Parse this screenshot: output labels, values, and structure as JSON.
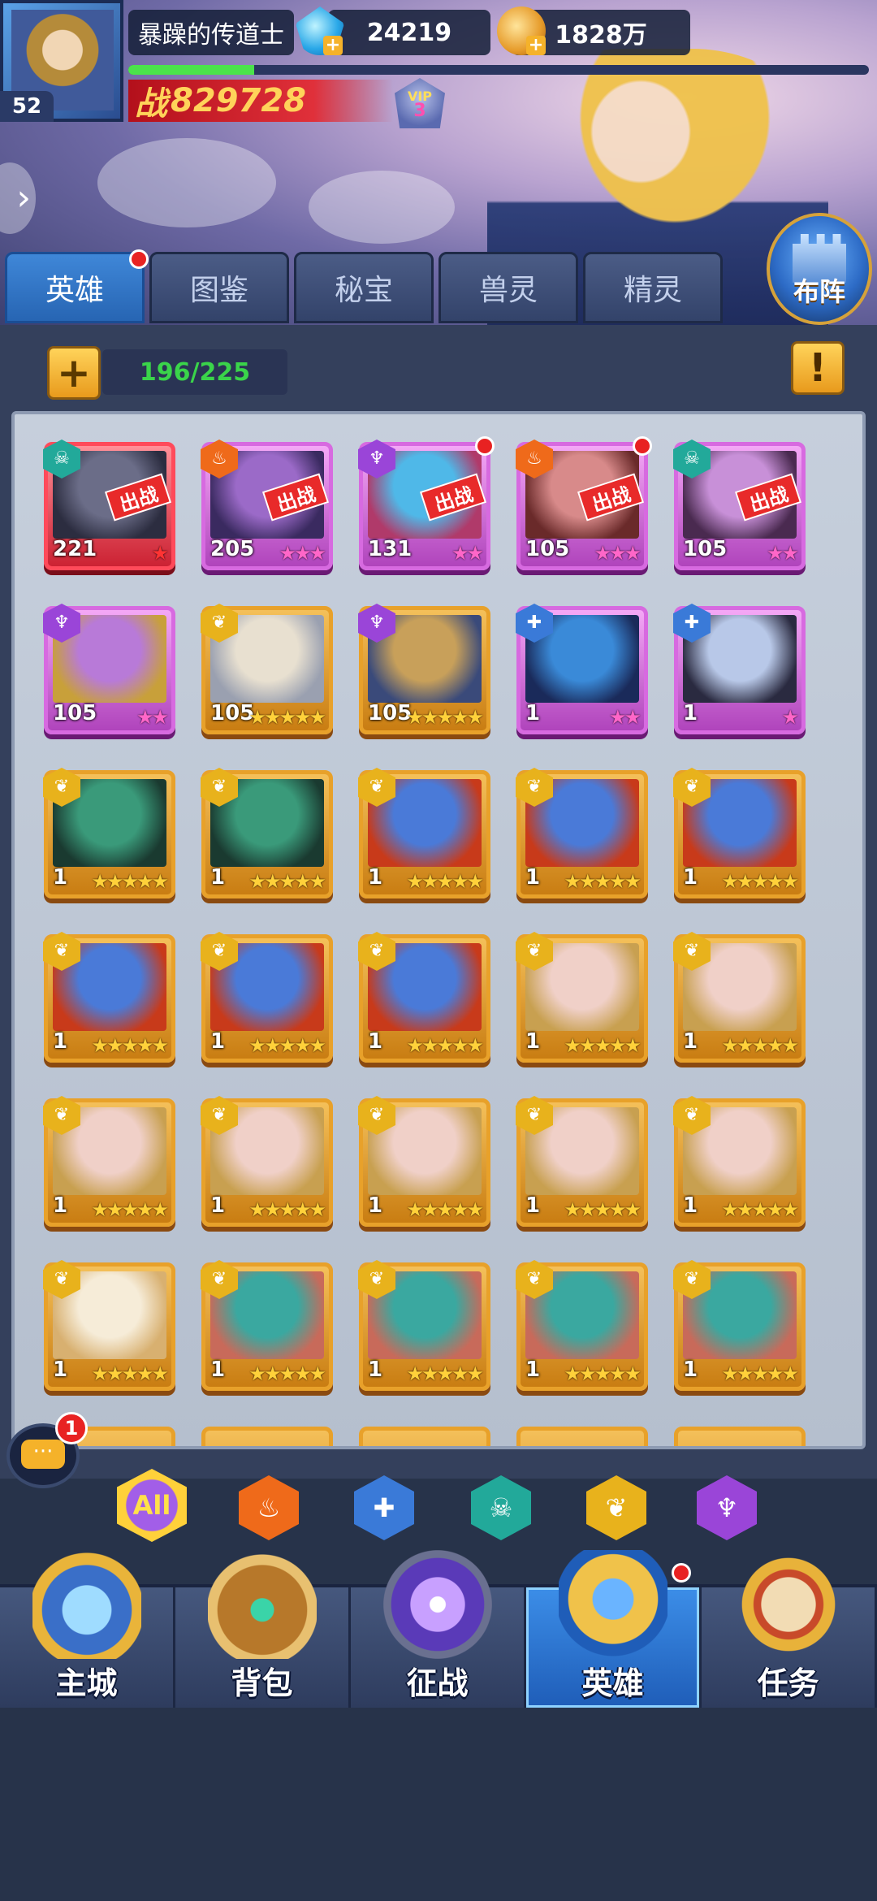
{
  "player": {
    "name": "暴躁的传道士",
    "level": "52",
    "gems": "24219",
    "gold": "1828万",
    "power_label": "战",
    "power": "829728",
    "vip_label": "VIP",
    "vip_level": "3",
    "xp_progress": 0.17
  },
  "tabs": [
    {
      "label": "英雄",
      "active": true,
      "has_notification": true
    },
    {
      "label": "图鉴",
      "active": false
    },
    {
      "label": "秘宝",
      "active": false
    },
    {
      "label": "兽灵",
      "active": false
    },
    {
      "label": "精灵",
      "active": false
    }
  ],
  "formation_label": "布阵",
  "hero_count": "196/225",
  "info_icon": "!",
  "deploy_tag": "出战",
  "heroes": [
    {
      "level": "221",
      "stars": 1,
      "star_color": "red",
      "rarity": "red",
      "faction": "skull",
      "deployed": true,
      "dot": false,
      "portrait": [
        "#6b6d88",
        "#2c2d40"
      ]
    },
    {
      "level": "205",
      "stars": 3,
      "star_color": "pink",
      "rarity": "purple",
      "faction": "fire",
      "deployed": true,
      "dot": false,
      "portrait": [
        "#9b6ac8",
        "#3a2a60"
      ]
    },
    {
      "level": "131",
      "stars": 2,
      "star_color": "pink",
      "rarity": "purple",
      "faction": "dark",
      "deployed": true,
      "dot": true,
      "portrait": [
        "#4fb8e8",
        "#b03a6a"
      ]
    },
    {
      "level": "105",
      "stars": 3,
      "star_color": "pink",
      "rarity": "purple",
      "faction": "fire",
      "deployed": true,
      "dot": true,
      "portrait": [
        "#d88a8a",
        "#6a2a2a"
      ]
    },
    {
      "level": "105",
      "stars": 2,
      "star_color": "pink",
      "rarity": "purple",
      "faction": "skull",
      "deployed": true,
      "dot": false,
      "portrait": [
        "#c890d8",
        "#4a2a50"
      ]
    },
    {
      "level": "105",
      "stars": 2,
      "star_color": "pink",
      "rarity": "purple",
      "faction": "dark",
      "deployed": false,
      "dot": false,
      "portrait": [
        "#b87ad8",
        "#c8a03a"
      ]
    },
    {
      "level": "105",
      "stars": 5,
      "star_color": "gold",
      "rarity": "gold",
      "faction": "leaf",
      "deployed": false,
      "dot": false,
      "portrait": [
        "#e8e0d0",
        "#9aa0b0"
      ]
    },
    {
      "level": "105",
      "stars": 5,
      "star_color": "gold",
      "rarity": "gold",
      "faction": "dark",
      "deployed": false,
      "dot": false,
      "portrait": [
        "#c8a05a",
        "#3a4a7a"
      ]
    },
    {
      "level": "1",
      "stars": 2,
      "star_color": "pink",
      "rarity": "purple",
      "faction": "holy",
      "deployed": false,
      "dot": false,
      "portrait": [
        "#3a8ad8",
        "#1a2a5a"
      ]
    },
    {
      "level": "1",
      "stars": 1,
      "star_color": "pink",
      "rarity": "purple",
      "faction": "holy",
      "deployed": false,
      "dot": false,
      "portrait": [
        "#b8c8e8",
        "#2a2a40"
      ]
    },
    {
      "level": "1",
      "stars": 5,
      "star_color": "gold",
      "rarity": "gold",
      "faction": "leaf",
      "deployed": false,
      "dot": false,
      "portrait": [
        "#3a9a7a",
        "#1a3a30"
      ]
    },
    {
      "level": "1",
      "stars": 5,
      "star_color": "gold",
      "rarity": "gold",
      "faction": "leaf",
      "deployed": false,
      "dot": false,
      "portrait": [
        "#3a9a7a",
        "#1a3a30"
      ]
    },
    {
      "level": "1",
      "stars": 5,
      "star_color": "gold",
      "rarity": "gold",
      "faction": "leaf",
      "deployed": false,
      "dot": false,
      "portrait": [
        "#4a7ad8",
        "#c83a1a"
      ]
    },
    {
      "level": "1",
      "stars": 5,
      "star_color": "gold",
      "rarity": "gold",
      "faction": "leaf",
      "deployed": false,
      "dot": false,
      "portrait": [
        "#4a7ad8",
        "#c83a1a"
      ]
    },
    {
      "level": "1",
      "stars": 5,
      "star_color": "gold",
      "rarity": "gold",
      "faction": "leaf",
      "deployed": false,
      "dot": false,
      "portrait": [
        "#4a7ad8",
        "#c83a1a"
      ]
    },
    {
      "level": "1",
      "stars": 5,
      "star_color": "gold",
      "rarity": "gold",
      "faction": "leaf",
      "deployed": false,
      "dot": false,
      "portrait": [
        "#4a7ad8",
        "#c83a1a"
      ]
    },
    {
      "level": "1",
      "stars": 5,
      "star_color": "gold",
      "rarity": "gold",
      "faction": "leaf",
      "deployed": false,
      "dot": false,
      "portrait": [
        "#4a7ad8",
        "#c83a1a"
      ]
    },
    {
      "level": "1",
      "stars": 5,
      "star_color": "gold",
      "rarity": "gold",
      "faction": "leaf",
      "deployed": false,
      "dot": false,
      "portrait": [
        "#4a7ad8",
        "#c83a1a"
      ]
    },
    {
      "level": "1",
      "stars": 5,
      "star_color": "gold",
      "rarity": "gold",
      "faction": "leaf",
      "deployed": false,
      "dot": false,
      "portrait": [
        "#f0d0c8",
        "#c8a050"
      ]
    },
    {
      "level": "1",
      "stars": 5,
      "star_color": "gold",
      "rarity": "gold",
      "faction": "leaf",
      "deployed": false,
      "dot": false,
      "portrait": [
        "#f0d0c8",
        "#c8a050"
      ]
    },
    {
      "level": "1",
      "stars": 5,
      "star_color": "gold",
      "rarity": "gold",
      "faction": "leaf",
      "deployed": false,
      "dot": false,
      "portrait": [
        "#f0d0c8",
        "#c8a050"
      ]
    },
    {
      "level": "1",
      "stars": 5,
      "star_color": "gold",
      "rarity": "gold",
      "faction": "leaf",
      "deployed": false,
      "dot": false,
      "portrait": [
        "#f0d0c8",
        "#c8a050"
      ]
    },
    {
      "level": "1",
      "stars": 5,
      "star_color": "gold",
      "rarity": "gold",
      "faction": "leaf",
      "deployed": false,
      "dot": false,
      "portrait": [
        "#f0d0c8",
        "#c8a050"
      ]
    },
    {
      "level": "1",
      "stars": 5,
      "star_color": "gold",
      "rarity": "gold",
      "faction": "leaf",
      "deployed": false,
      "dot": false,
      "portrait": [
        "#f0d0c8",
        "#c8a050"
      ]
    },
    {
      "level": "1",
      "stars": 5,
      "star_color": "gold",
      "rarity": "gold",
      "faction": "leaf",
      "deployed": false,
      "dot": false,
      "portrait": [
        "#f0d0c8",
        "#c8a050"
      ]
    },
    {
      "level": "1",
      "stars": 5,
      "star_color": "gold",
      "rarity": "gold",
      "faction": "leaf",
      "deployed": false,
      "dot": false,
      "portrait": [
        "#f6ecd8",
        "#d8b070"
      ]
    },
    {
      "level": "1",
      "stars": 5,
      "star_color": "gold",
      "rarity": "gold",
      "faction": "leaf",
      "deployed": false,
      "dot": false,
      "portrait": [
        "#3aa8a0",
        "#c86a5a"
      ]
    },
    {
      "level": "1",
      "stars": 5,
      "star_color": "gold",
      "rarity": "gold",
      "faction": "leaf",
      "deployed": false,
      "dot": false,
      "portrait": [
        "#3aa8a0",
        "#c86a5a"
      ]
    },
    {
      "level": "1",
      "stars": 5,
      "star_color": "gold",
      "rarity": "gold",
      "faction": "leaf",
      "deployed": false,
      "dot": false,
      "portrait": [
        "#3aa8a0",
        "#c86a5a"
      ]
    },
    {
      "level": "1",
      "stars": 5,
      "star_color": "gold",
      "rarity": "gold",
      "faction": "leaf",
      "deployed": false,
      "dot": false,
      "portrait": [
        "#3aa8a0",
        "#c86a5a"
      ]
    }
  ],
  "filters": [
    {
      "name": "all",
      "label": "All"
    },
    {
      "name": "fire",
      "label": ""
    },
    {
      "name": "holy",
      "label": ""
    },
    {
      "name": "skull",
      "label": ""
    },
    {
      "name": "leaf",
      "label": ""
    },
    {
      "name": "dark",
      "label": ""
    }
  ],
  "chat_badge": "1",
  "nav": [
    {
      "label": "主城",
      "icon": "castle-icon",
      "active": false
    },
    {
      "label": "背包",
      "icon": "treasure-chest-icon",
      "active": false
    },
    {
      "label": "征战",
      "icon": "dragon-portal-icon",
      "active": false
    },
    {
      "label": "英雄",
      "icon": "hero-helmet-icon",
      "active": true,
      "has_notification": true
    },
    {
      "label": "任务",
      "icon": "scroll-icon",
      "active": false
    }
  ]
}
